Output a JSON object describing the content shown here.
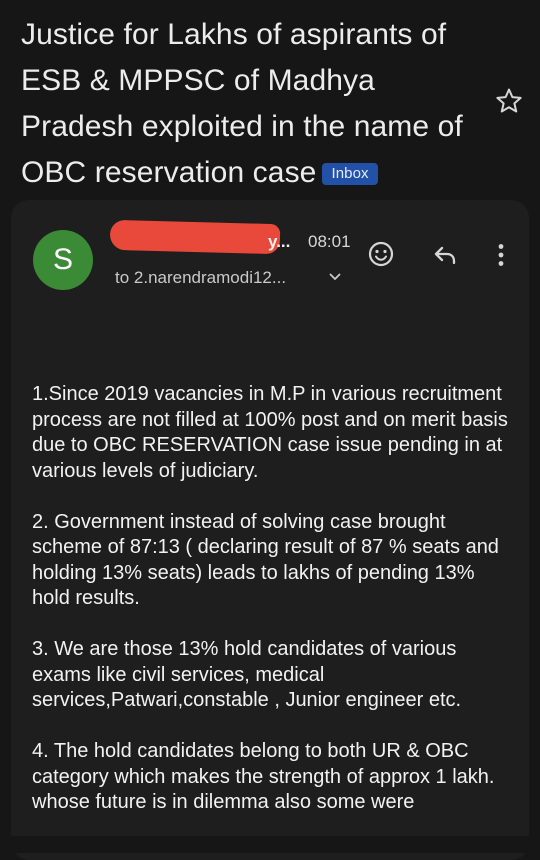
{
  "email": {
    "subject": "Justice for Lakhs of aspirants of ESB & MPPSC of Madhya Pradesh exploited in the name of OBC reservation case",
    "label": "Inbox",
    "sender_initial": "S",
    "sender_tail": "y...",
    "time": "08:01",
    "recipient": "to 2.narendramodi12...",
    "paragraphs": [
      "1.Since 2019 vacancies in M.P in various recruitment process are not filled at 100% post and on merit basis due to OBC RESERVATION case issue pending in at various levels of judiciary.",
      "2. Government instead of solving case brought scheme of 87:13 ( declaring result of 87 % seats and holding 13% seats) leads to lakhs of pending 13% hold results.",
      "3. We are those 13% hold candidates of various exams like civil services, medical services,Patwari,constable , Junior engineer etc.",
      "4. The hold candidates belong to both UR & OBC category which makes the strength of approx 1 lakh. whose future is in dilemma also some were"
    ]
  },
  "icons": {
    "star": "star-outline-icon",
    "emoji": "smiley-icon",
    "reply": "reply-icon",
    "more": "more-vert-icon",
    "expand": "chevron-down-icon"
  },
  "colors": {
    "background": "#161616",
    "card": "#1e1e1e",
    "avatar": "#3b8a36",
    "label_badge": "#2451a8",
    "redaction": "#e8493a"
  }
}
